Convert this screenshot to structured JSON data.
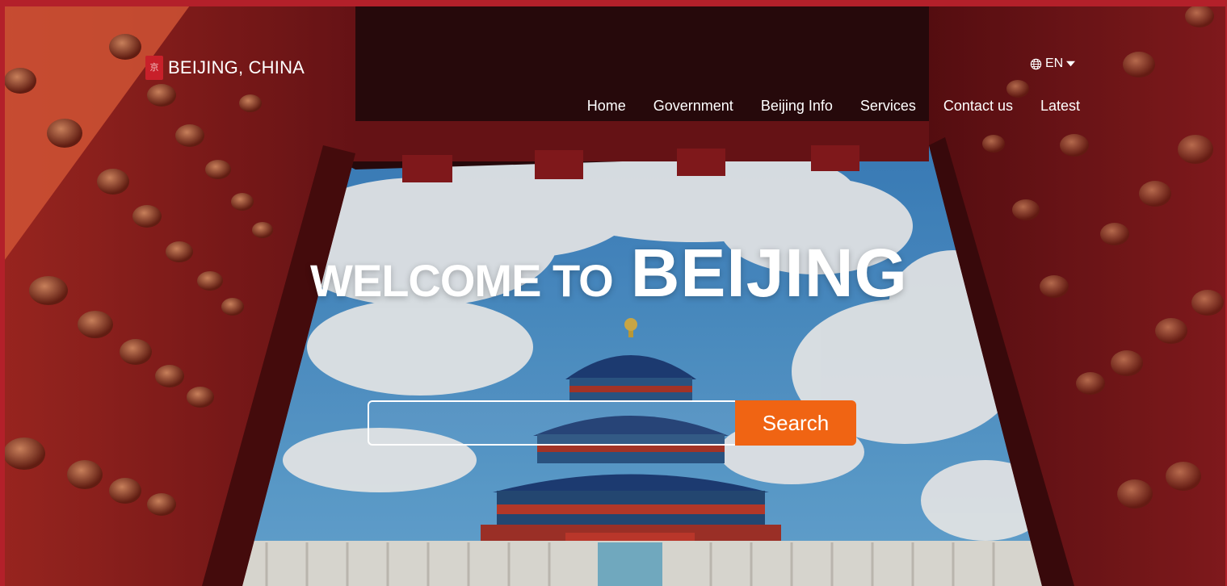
{
  "header": {
    "logo_seal": "京",
    "logo_text": "BEIJING, CHINA",
    "language": "EN",
    "language_icon": "globe-icon"
  },
  "nav": {
    "items": [
      {
        "label": "Home"
      },
      {
        "label": "Government"
      },
      {
        "label": "Beijing Info"
      },
      {
        "label": "Services"
      },
      {
        "label": "Contact us"
      },
      {
        "label": "Latest"
      }
    ]
  },
  "hero": {
    "welcome": "WELCOME TO",
    "city": "BEIJING"
  },
  "search": {
    "placeholder": "",
    "value": "",
    "button_label": "Search"
  },
  "colors": {
    "frame": "#b3202a",
    "accent": "#f06413",
    "text": "#ffffff"
  }
}
